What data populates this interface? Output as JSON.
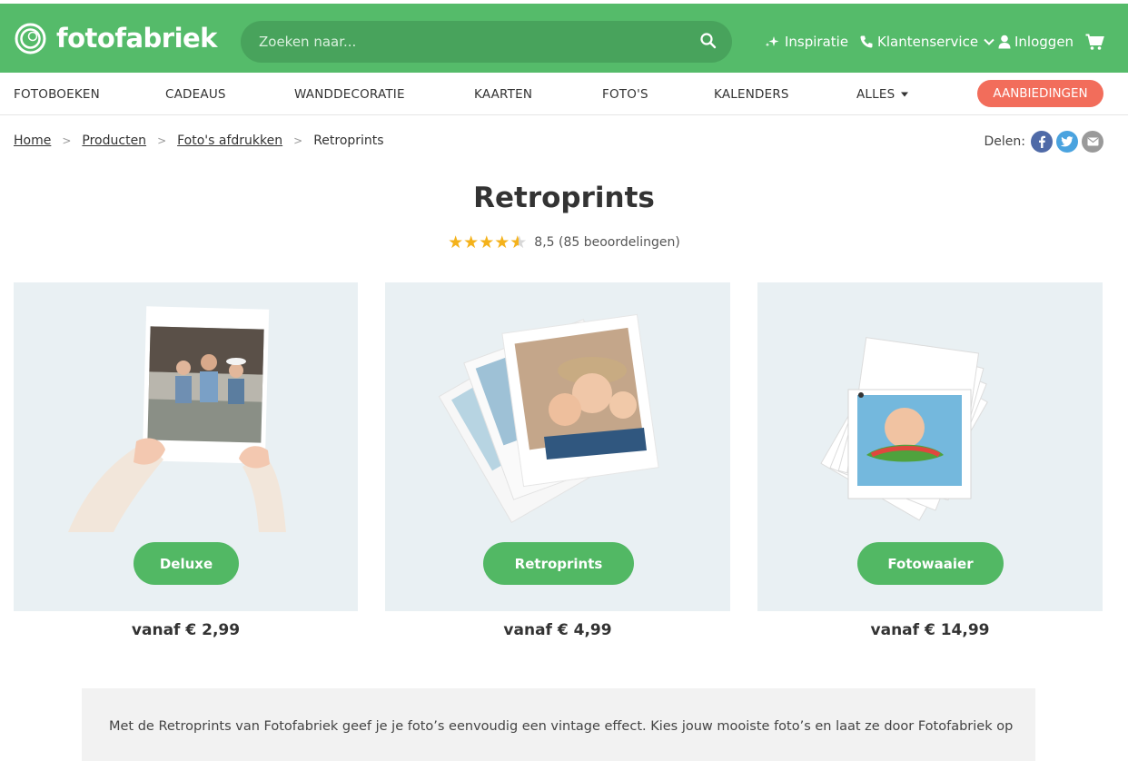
{
  "brand": {
    "name": "fotofabriek",
    "color": "#55bb6a"
  },
  "search": {
    "placeholder": "Zoeken naar..."
  },
  "header_nav": {
    "inspiration": "Inspiratie",
    "customer_service": "Klantenservice",
    "login": "Inloggen"
  },
  "categories": [
    "FOTOBOEKEN",
    "CADEAUS",
    "WANDDECORATIE",
    "KAARTEN",
    "FOTO'S",
    "KALENDERS",
    "ALLES"
  ],
  "deals_label": "AANBIEDINGEN",
  "breadcrumb": {
    "items": [
      "Home",
      "Producten",
      "Foto's afdrukken"
    ],
    "current": "Retroprints"
  },
  "share": {
    "label": "Delen:"
  },
  "page": {
    "title": "Retroprints",
    "rating_stars": "★★★★",
    "rating_text": "8,5 (85 beoordelingen)"
  },
  "products": [
    {
      "label": "Deluxe",
      "price": "vanaf € 2,99"
    },
    {
      "label": "Retroprints",
      "price": "vanaf € 4,99"
    },
    {
      "label": "Fotowaaier",
      "price": "vanaf € 14,99"
    }
  ],
  "description": "Met de Retroprints van Fotofabriek geef je je foto’s eenvoudig een vintage effect. Kies jouw mooiste foto’s en laat ze door Fotofabriek op"
}
